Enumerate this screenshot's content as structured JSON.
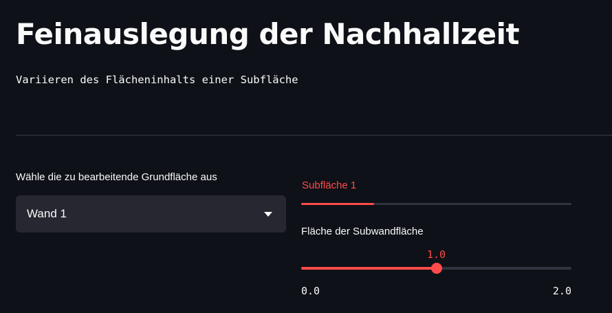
{
  "header": {
    "title": "Feinauslegung der Nachhallzeit",
    "subtitle": "Variieren des Flächeninhalts einer Subfläche"
  },
  "grundflaeche_select": {
    "label": "Wähle die zu bearbeitende Grundfläche aus",
    "selected": "Wand 1",
    "icon": "chevron-down-icon"
  },
  "tabs": [
    {
      "label": "Subfläche 1",
      "active": true
    }
  ],
  "slider": {
    "label": "Fläche der Subwandfläche",
    "value": "1.0",
    "min": "0.0",
    "max": "2.0",
    "fraction": 0.5
  },
  "colors": {
    "background": "#0e1117",
    "accent": "#ff4b4b",
    "input_background": "#262730",
    "track": "#31333f",
    "text": "#fafafa"
  }
}
